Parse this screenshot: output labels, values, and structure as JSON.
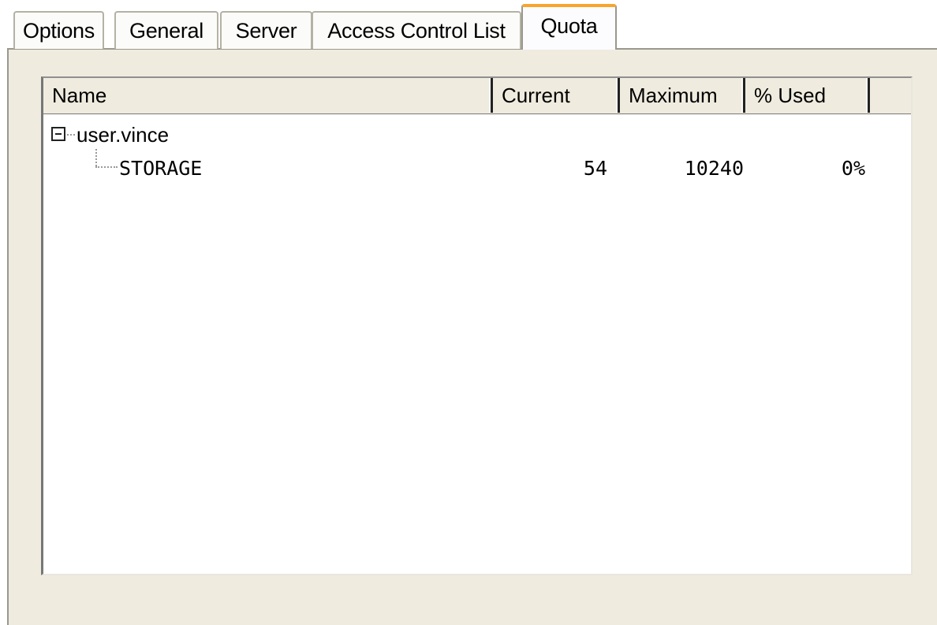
{
  "tabs": [
    {
      "label": "Options"
    },
    {
      "label": "General"
    },
    {
      "label": "Server"
    },
    {
      "label": "Access Control List"
    },
    {
      "label": "Quota"
    }
  ],
  "active_tab": "Quota",
  "columns": [
    "Name",
    "Current",
    "Maximum",
    "% Used"
  ],
  "tree": {
    "root": {
      "label": "user.vince",
      "expanded": true
    },
    "children": [
      {
        "name": "STORAGE",
        "current": "54",
        "maximum": "10240",
        "used": "0%"
      }
    ]
  }
}
